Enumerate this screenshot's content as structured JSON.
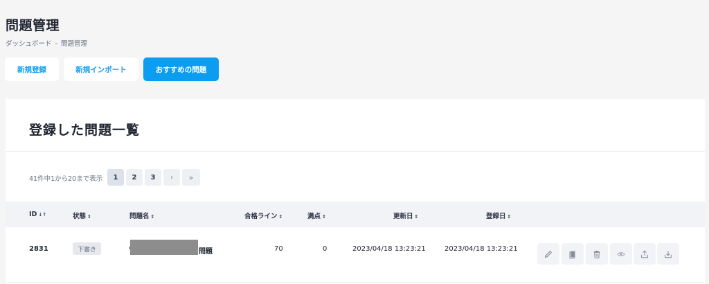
{
  "header": {
    "title": "問題管理",
    "breadcrumb": [
      "ダッシュボード",
      "問題管理"
    ],
    "breadcrumb_sep": "-"
  },
  "actions": {
    "new_register": "新規登録",
    "new_import": "新規インポート",
    "recommended": "おすすめの問題"
  },
  "card": {
    "title": "登録した問題一覧",
    "pagination": {
      "info": "41件中1から20まで表示",
      "pages": [
        "1",
        "2",
        "3"
      ],
      "current_page": 1,
      "next": "›",
      "last": "»"
    },
    "table": {
      "columns": [
        "ID",
        "状態",
        "問題名",
        "合格ライン",
        "満点",
        "更新日",
        "登録日"
      ],
      "sort_icons": [
        "↓↑",
        "⇕",
        "⇕",
        "⇕",
        "⇕",
        "⇕",
        "⇕"
      ],
      "rows": [
        {
          "id": "2831",
          "status": "下書き",
          "name_visible_suffix": "問題",
          "pass_line": "70",
          "full_score": "0",
          "updated_at": "2023/04/18 13:23:21",
          "created_at": "2023/04/18 13:23:21",
          "actions": [
            "pencil-icon",
            "copy-icon",
            "trash-icon",
            "eye-icon",
            "upload-icon",
            "download-icon"
          ]
        }
      ]
    }
  },
  "colors": {
    "accent": "#0b9df0",
    "background": "#f5f5f6",
    "card": "#ffffff",
    "header_row": "#f2f3f6"
  }
}
